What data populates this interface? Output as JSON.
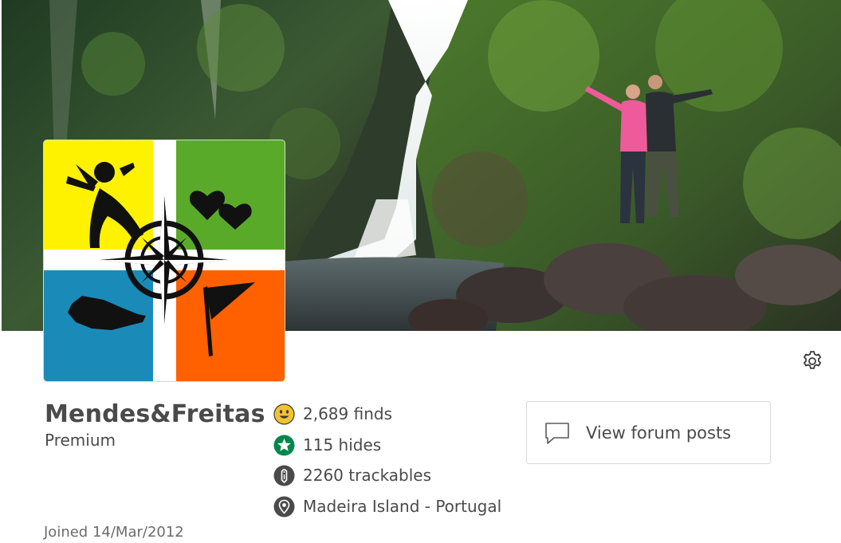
{
  "profile": {
    "username": "Mendes&Freitas",
    "membership": "Premium",
    "joined": "Joined 14/Mar/2012"
  },
  "stats": [
    {
      "icon": "smiley-finds-icon",
      "label": "2,689 finds"
    },
    {
      "icon": "star-hides-icon",
      "label": "115 hides"
    },
    {
      "icon": "trackable-icon",
      "label": "2260 trackables"
    },
    {
      "icon": "location-pin-icon",
      "label": "Madeira Island - Portugal"
    }
  ],
  "actions": {
    "forum_label": "View forum posts",
    "forum_icon": "speech-bubble-icon",
    "settings_icon": "gear-icon"
  },
  "colors": {
    "text": "#4a4a4a",
    "finds_yellow": "#f2c230",
    "hides_green": "#02874d",
    "icon_dark": "#4a4a4a",
    "avatar_yellow": "#fff200",
    "avatar_green": "#5aaa2a",
    "avatar_blue": "#1a8bb8",
    "avatar_orange": "#ff6000"
  }
}
